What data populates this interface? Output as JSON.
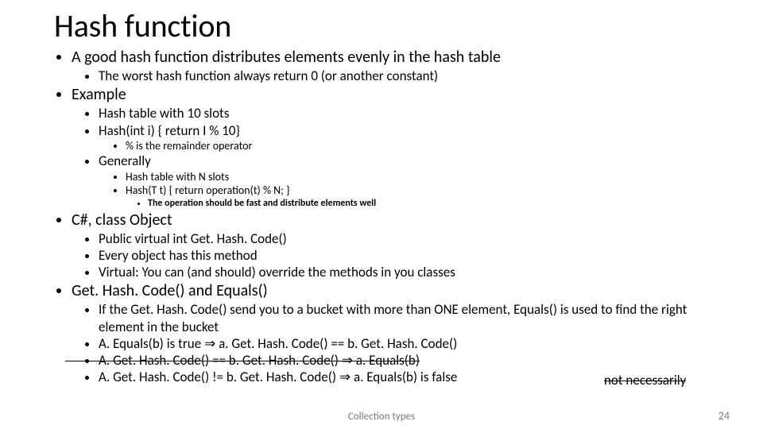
{
  "title": "Hash function",
  "b1": "A good hash function distributes elements evenly in the hash table",
  "b1_1": "The worst hash function always return 0 (or another constant)",
  "b2": "Example",
  "b2_1": "Hash table with 10 slots",
  "b2_2": "Hash(int i) { return I % 10}",
  "b2_2_1": "% is the remainder operator",
  "b2_3": "Generally",
  "b2_3_1": "Hash table with N slots",
  "b2_3_2": "Hash(T t) { return operation(t) % N; }",
  "b2_3_2_1": "The operation should be fast and distribute elements well",
  "b3": "C#, class Object",
  "b3_1": "Public virtual int Get. Hash. Code()",
  "b3_2": "Every object has this method",
  "b3_3": "Virtual: You can (and should) override the methods in you classes",
  "b4": "Get. Hash. Code() and Equals()",
  "b4_1": "If the Get. Hash. Code() send you to a bucket with more than ONE element, Equals() is used to find the right element in the bucket",
  "b4_2": "A. Equals(b) is true ⇒ a. Get. Hash. Code() == b. Get. Hash. Code()",
  "b4_3": "A. Get. Hash. Code() == b. Get. Hash. Code() ⇒ a. Equals(b)",
  "b4_3_note": "not necessarily",
  "b4_4": "A. Get. Hash. Code() != b. Get. Hash. Code() ⇒ a. Equals(b) is false",
  "footer_center": "Collection types",
  "footer_right": "24"
}
